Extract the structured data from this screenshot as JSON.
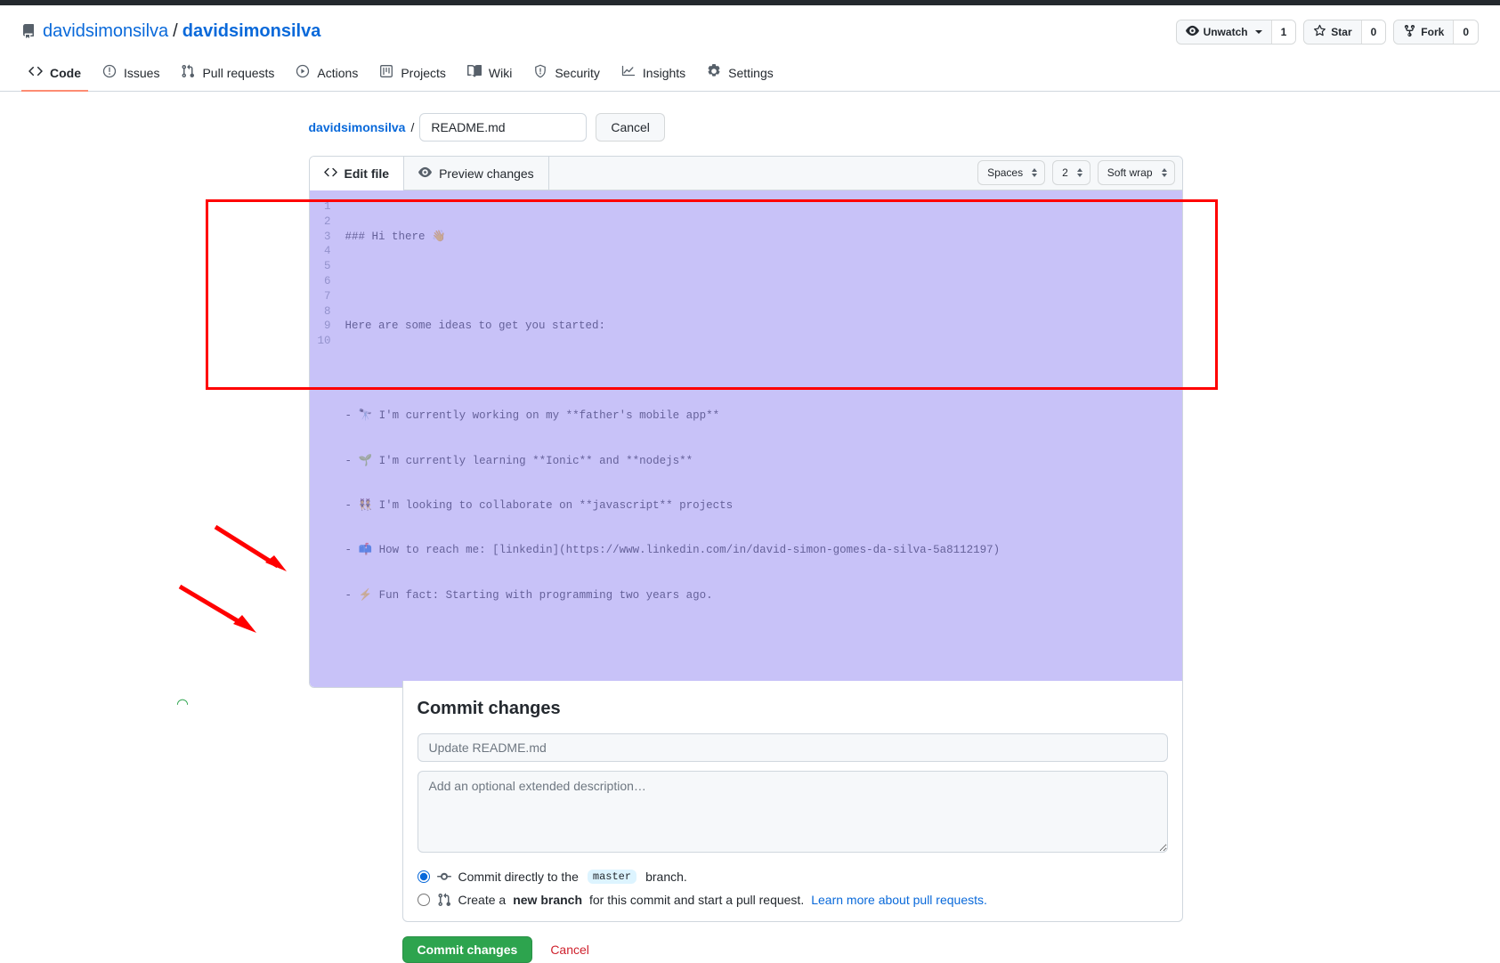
{
  "header": {
    "repo_icon": "repo-icon",
    "owner": "davidsimonsilva",
    "separator": "/",
    "repo": "davidsimonsilva",
    "actions": {
      "watch_label": "Unwatch",
      "watch_count": "1",
      "star_label": "Star",
      "star_count": "0",
      "fork_label": "Fork",
      "fork_count": "0"
    }
  },
  "nav": {
    "tabs": [
      {
        "label": "Code",
        "icon": "code-icon",
        "active": true
      },
      {
        "label": "Issues",
        "icon": "issue-opened-icon",
        "active": false
      },
      {
        "label": "Pull requests",
        "icon": "git-pull-request-icon",
        "active": false
      },
      {
        "label": "Actions",
        "icon": "play-icon",
        "active": false
      },
      {
        "label": "Projects",
        "icon": "project-icon",
        "active": false
      },
      {
        "label": "Wiki",
        "icon": "book-icon",
        "active": false
      },
      {
        "label": "Security",
        "icon": "shield-icon",
        "active": false
      },
      {
        "label": "Insights",
        "icon": "graph-icon",
        "active": false
      },
      {
        "label": "Settings",
        "icon": "gear-icon",
        "active": false
      }
    ]
  },
  "file_path": {
    "owner": "davidsimonsilva",
    "slash": "/",
    "filename_value": "README.md",
    "cancel_label": "Cancel"
  },
  "editor": {
    "tab_edit": "Edit file",
    "tab_preview": "Preview changes",
    "select_indent_mode": "Spaces",
    "select_indent_size": "2",
    "select_wrap": "Soft wrap",
    "line_numbers": [
      "1",
      "2",
      "3",
      "4",
      "5",
      "6",
      "7",
      "8",
      "9",
      "10"
    ],
    "lines": [
      "### Hi there 👋",
      "",
      "Here are some ideas to get you started:",
      "",
      "- 🔭 I'm currently working on my **father's mobile app**",
      "- 🌱 I'm currently learning **Ionic** and **nodejs**",
      "- 👯 I'm looking to collaborate on **javascript** projects",
      "- 📫 How to reach me: [linkedin](https://www.linkedin.com/in/david-simon-gomes-da-silva-5a8112197)",
      "- ⚡ Fun fact: Starting with programming two years ago.",
      ""
    ]
  },
  "commit": {
    "title": "Commit changes",
    "summary_placeholder": "Update README.md",
    "description_placeholder": "Add an optional extended description…",
    "option_direct_prefix": "Commit directly to the",
    "option_direct_branch": "master",
    "option_direct_suffix": "branch.",
    "option_branch_prefix": "Create a",
    "option_branch_bold": "new branch",
    "option_branch_mid": "for this commit and start a pull request.",
    "option_branch_link": "Learn more about pull requests.",
    "selected_option": "direct"
  },
  "footer": {
    "commit_label": "Commit changes",
    "cancel_label": "Cancel"
  },
  "colors": {
    "accent_blue": "#0969da",
    "green_button": "#2da44e",
    "red_annotation": "#ff0000",
    "selection_purple": "#9b90f2",
    "danger_red": "#cf222e",
    "tab_active_underline": "#fd8c73"
  }
}
